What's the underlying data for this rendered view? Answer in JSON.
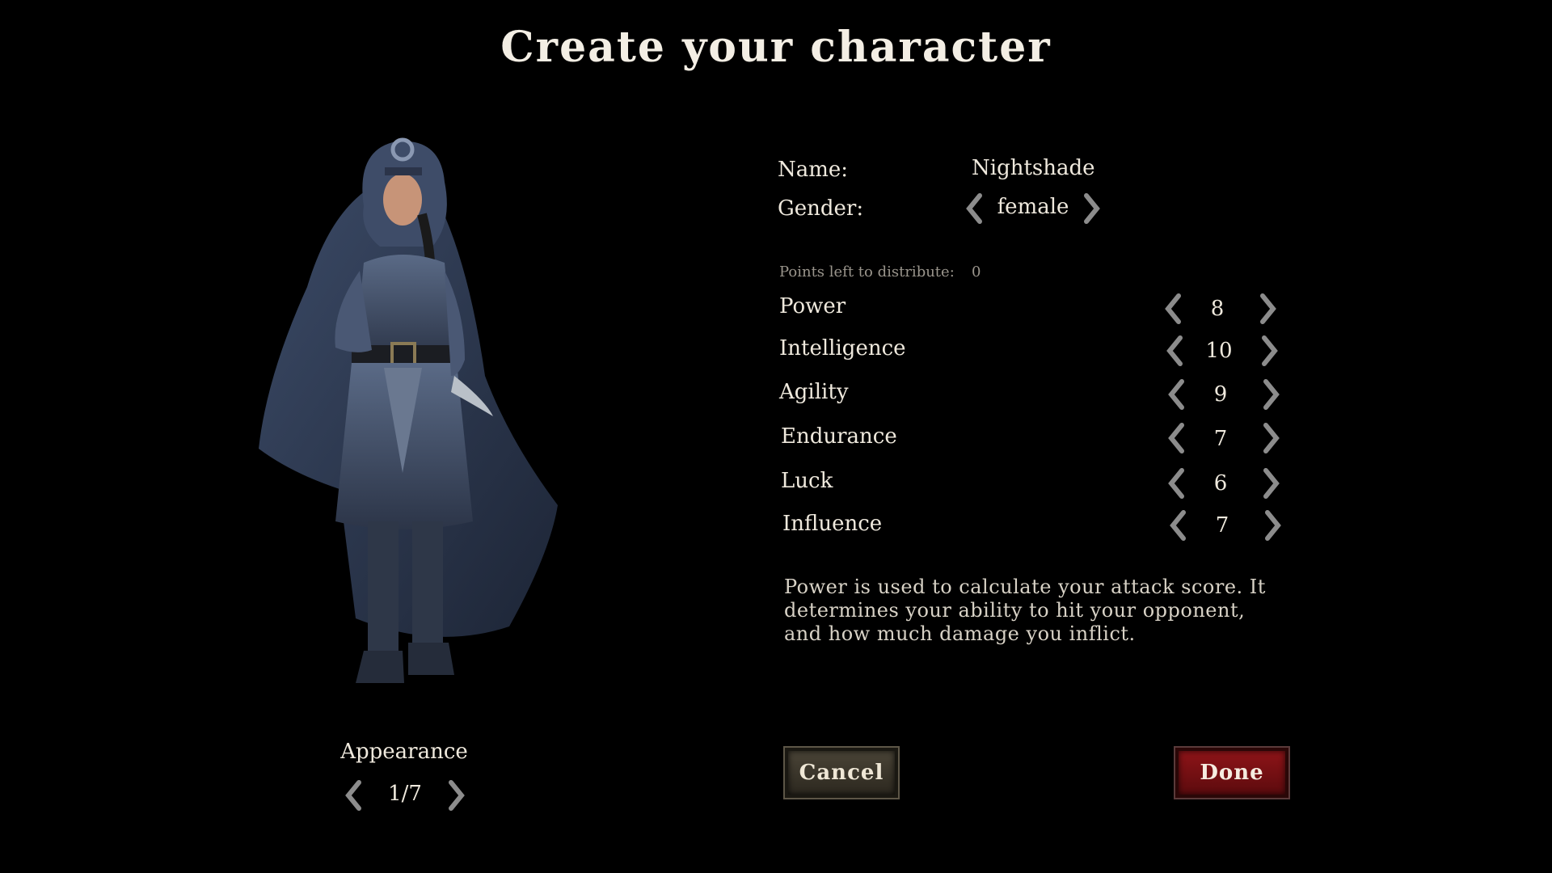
{
  "title": "Create your character",
  "appearance": {
    "label": "Appearance",
    "value": "1/7"
  },
  "name": {
    "label": "Name:",
    "value": "Nightshade"
  },
  "gender": {
    "label": "Gender:",
    "value": "female"
  },
  "points": {
    "label": "Points left to distribute:",
    "value": "0"
  },
  "stats": [
    {
      "label": "Power",
      "value": "8"
    },
    {
      "label": "Intelligence",
      "value": "10"
    },
    {
      "label": "Agility",
      "value": "9"
    },
    {
      "label": "Endurance",
      "value": "7"
    },
    {
      "label": "Luck",
      "value": "6"
    },
    {
      "label": "Influence",
      "value": "7"
    }
  ],
  "description": "Power is used to calculate your attack score.  It determines your ability to hit your opponent, and how much damage you inflict.",
  "buttons": {
    "cancel": "Cancel",
    "done": "Done"
  },
  "colors": {
    "background": "#000000",
    "text": "#ece6da",
    "arrow": "#8c8c8c",
    "done": "#8e1418",
    "cancel": "#3c372c"
  },
  "icons": {
    "left": "chevron-left-icon",
    "right": "chevron-right-icon"
  }
}
